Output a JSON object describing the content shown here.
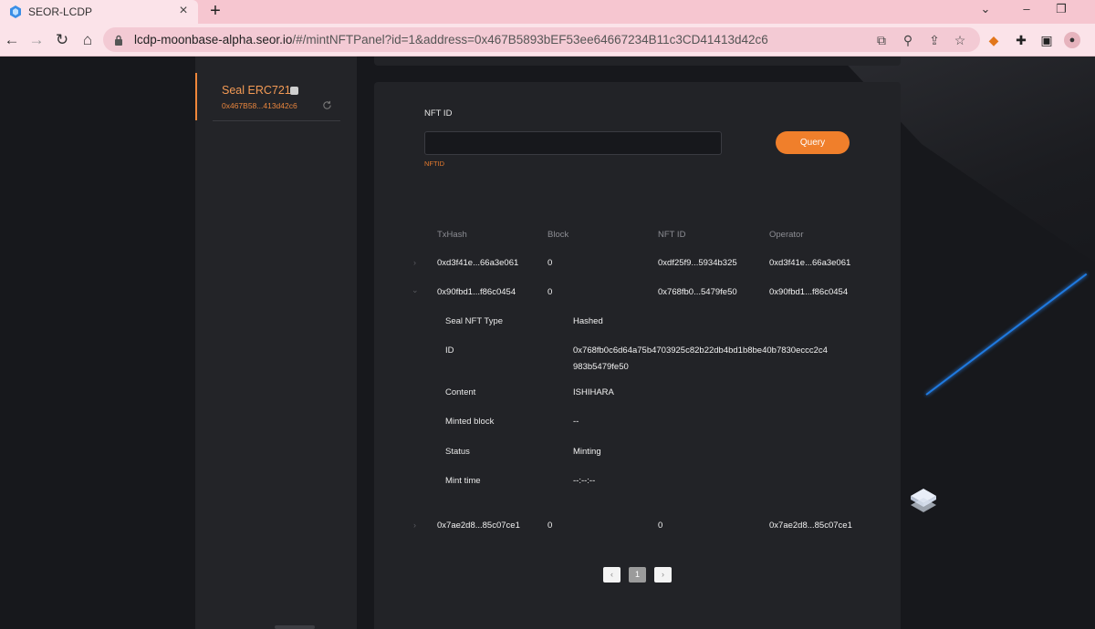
{
  "browser": {
    "tab_title": "SEOR-LCDP",
    "tab_close": "×",
    "new_tab": "+",
    "url_host": "lcdp-moonbase-alpha.seor.io",
    "url_path": "/#/mintNFTPanel?id=1&address=0x467B5893bEF53ee64667234B11c3CD41413d42c6"
  },
  "sidebar": {
    "active_title": "Seal ERC721",
    "active_address": "0x467B58...413d42c6"
  },
  "query": {
    "label": "NFT ID",
    "input_value": "",
    "hint": "NFTID",
    "button_label": "Query"
  },
  "table": {
    "headers": [
      "TxHash",
      "Block",
      "NFT ID",
      "Operator"
    ],
    "rows": [
      {
        "arrow": "›",
        "txhash": "0xd3f41e...66a3e061",
        "block": "0",
        "nft_id": "0xdf25f9...5934b325",
        "operator": "0xd3f41e...66a3e061"
      },
      {
        "arrow": "⌄",
        "txhash": "0x90fbd1...f86c0454",
        "block": "0",
        "nft_id": "0x768fb0...5479fe50",
        "operator": "0x90fbd1...f86c0454"
      },
      {
        "arrow": "›",
        "txhash": "0x7ae2d8...85c07ce1",
        "block": "0",
        "nft_id": "0",
        "operator": "0x7ae2d8...85c07ce1"
      }
    ],
    "detail": {
      "type_label": "Seal NFT Type",
      "type_value": "Hashed",
      "id_label": "ID",
      "id_value_line1": "0x768fb0c6d64a75b4703925c82b22db4bd1b8be40b7830eccc2c4",
      "id_value_line2": "983b5479fe50",
      "content_label": "Content",
      "content_value": "ISHIHARA",
      "minted_label": "Minted block",
      "minted_value": "--",
      "status_label": "Status",
      "status_value": "Minting",
      "mint_time_label": "Mint time",
      "mint_time_value": "--:--:--"
    }
  },
  "pagination": {
    "prev": "‹",
    "current": "1",
    "next": "›"
  },
  "colors": {
    "accent": "#f07f2b",
    "panel": "#222327",
    "background": "#17181c"
  }
}
